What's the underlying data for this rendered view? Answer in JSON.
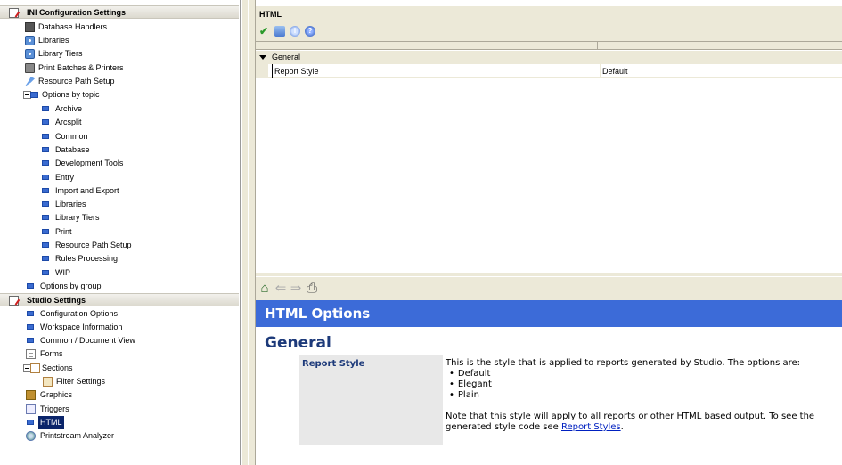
{
  "tree": {
    "ini_section": "INI Configuration Settings",
    "ini_items": [
      {
        "label": "Database Handlers",
        "icon": "database-icon"
      },
      {
        "label": "Libraries",
        "icon": "library-icon"
      },
      {
        "label": "Library Tiers",
        "icon": "library-icon"
      },
      {
        "label": "Print Batches & Printers",
        "icon": "printer-icon"
      },
      {
        "label": "Resource Path Setup",
        "icon": "path-icon"
      }
    ],
    "options_by_topic": "Options by topic",
    "topics": [
      "Archive",
      "Arcsplit",
      "Common",
      "Database",
      "Development Tools",
      "Entry",
      "Import and Export",
      "Libraries",
      "Library Tiers",
      "Print",
      "Resource Path Setup",
      "Rules Processing",
      "WIP"
    ],
    "options_by_group": "Options by group",
    "studio_section": "Studio Settings",
    "studio_items": [
      {
        "label": "Configuration Options"
      },
      {
        "label": "Workspace Information"
      },
      {
        "label": "Common / Document View"
      },
      {
        "label": "Forms"
      },
      {
        "label": "Sections"
      },
      {
        "label": "Filter Settings"
      },
      {
        "label": "Graphics"
      },
      {
        "label": "Triggers"
      },
      {
        "label": "HTML"
      },
      {
        "label": "Printstream Analyzer"
      }
    ],
    "selected": "HTML"
  },
  "properties": {
    "title": "HTML",
    "toolbar_icons": [
      "apply-check-icon",
      "sort-icon",
      "info-icon",
      "help-icon"
    ],
    "category": "General",
    "rows": [
      {
        "name": "Report Style",
        "value": "Default"
      }
    ]
  },
  "help": {
    "banner": "HTML Options",
    "heading": "General",
    "term": "Report Style",
    "intro": "This is the style that is applied to reports generated by Studio. The options are:",
    "options": [
      "Default",
      "Elegant",
      "Plain"
    ],
    "note_prefix": "Note that this style will apply to all reports or other HTML based output. To see the generated style code see ",
    "note_link": "Report Styles",
    "note_suffix": "."
  },
  "colors": {
    "banner": "#3c6bd8",
    "selection": "#0a246a",
    "chrome": "#ece9d8"
  }
}
